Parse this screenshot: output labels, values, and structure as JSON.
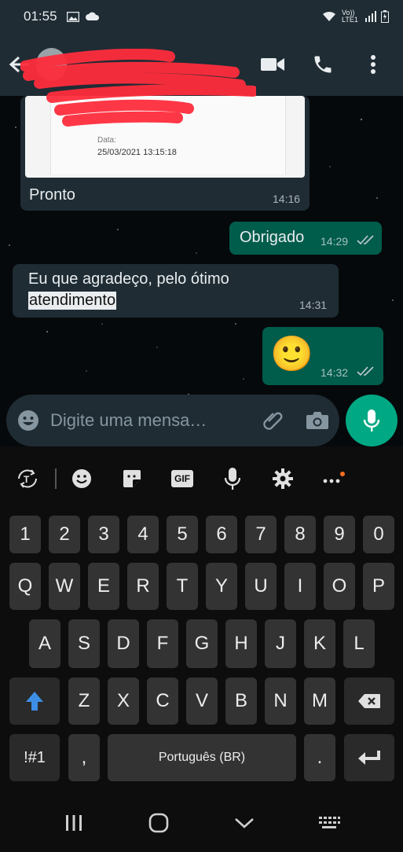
{
  "status_bar": {
    "time": "01:55",
    "network": "Vo)) LTE1"
  },
  "header": {
    "contact_name": ""
  },
  "messages": [
    {
      "direction": "in",
      "caption": "Pronto",
      "time": "14:16",
      "attachment": {
        "date_label": "Data:",
        "date_value": "25/03/2021 13:15:18"
      }
    },
    {
      "direction": "out",
      "text": "Obrigado",
      "time": "14:29",
      "ticks": "read"
    },
    {
      "direction": "in",
      "text_line1": "Eu que agradeço, pelo ótimo",
      "text_line2": "atendimento",
      "time": "14:31"
    },
    {
      "direction": "out",
      "emoji": "🙂",
      "time": "14:32",
      "ticks": "read"
    }
  ],
  "composer": {
    "placeholder": "Digite uma mensa…"
  },
  "keyboard": {
    "number_row": [
      "1",
      "2",
      "3",
      "4",
      "5",
      "6",
      "7",
      "8",
      "9",
      "0"
    ],
    "row1": [
      "Q",
      "W",
      "E",
      "R",
      "T",
      "Y",
      "U",
      "I",
      "O",
      "P"
    ],
    "row2": [
      "A",
      "S",
      "D",
      "F",
      "G",
      "H",
      "J",
      "K",
      "L"
    ],
    "row3": [
      "Z",
      "X",
      "C",
      "V",
      "B",
      "N",
      "M"
    ],
    "symbols_key": "!#1",
    "comma_key": ",",
    "space_label": "Português (BR)",
    "period_key": ".",
    "gif_label": "GIF"
  },
  "colors": {
    "accent": "#00a884",
    "outgoing_bubble": "#005c4b",
    "incoming_bubble": "#1f2c34",
    "read_ticks": "#8696a0"
  }
}
